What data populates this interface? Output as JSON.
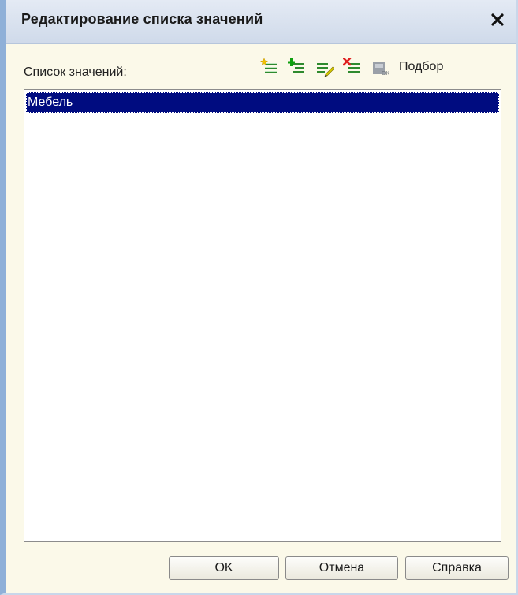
{
  "dialog": {
    "title": "Редактирование списка значений",
    "list_label": "Список значений:",
    "toolbar": {
      "icons": [
        "add-item-icon",
        "add-subitem-icon",
        "edit-item-icon",
        "delete-item-icon",
        "save-item-icon"
      ],
      "select_label": "Подбор"
    },
    "items": [
      {
        "label": "Мебель",
        "selected": true
      }
    ],
    "buttons": {
      "ok": "OK",
      "cancel": "Отмена",
      "help": "Справка"
    }
  },
  "colors": {
    "selection": "#000c80",
    "titlebar": "#d9e2ef",
    "dialog_bg": "#fbf9e9"
  }
}
